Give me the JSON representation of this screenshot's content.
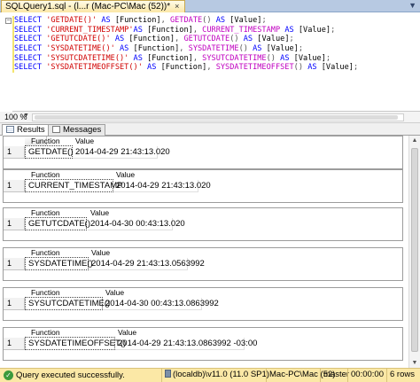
{
  "document_tab": {
    "title": "SQLQuery1.sql - (l...r (Mac-PC\\Mac (52))*",
    "close_glyph": "×"
  },
  "editor": {
    "lines": [
      [
        {
          "t": "SELECT ",
          "c": "kw"
        },
        {
          "t": "'GETDATE()'",
          "c": "str"
        },
        {
          "t": " AS ",
          "c": "kw"
        },
        {
          "t": "[Function]",
          "c": "plain"
        },
        {
          "t": ", ",
          "c": "op"
        },
        {
          "t": "GETDATE",
          "c": "fn"
        },
        {
          "t": "() ",
          "c": "op"
        },
        {
          "t": "AS ",
          "c": "kw"
        },
        {
          "t": "[Value]",
          "c": "plain"
        },
        {
          "t": ";",
          "c": "op"
        }
      ],
      [
        {
          "t": "SELECT ",
          "c": "kw"
        },
        {
          "t": "'CURRENT_TIMESTAMP'",
          "c": "str"
        },
        {
          "t": "AS ",
          "c": "kw"
        },
        {
          "t": "[Function]",
          "c": "plain"
        },
        {
          "t": ", ",
          "c": "op"
        },
        {
          "t": "CURRENT_TIMESTAMP",
          "c": "fn"
        },
        {
          "t": " AS ",
          "c": "kw"
        },
        {
          "t": "[Value]",
          "c": "plain"
        },
        {
          "t": ";",
          "c": "op"
        }
      ],
      [
        {
          "t": "SELECT ",
          "c": "kw"
        },
        {
          "t": "'GETUTCDATE()'",
          "c": "str"
        },
        {
          "t": " AS ",
          "c": "kw"
        },
        {
          "t": "[Function]",
          "c": "plain"
        },
        {
          "t": ", ",
          "c": "op"
        },
        {
          "t": "GETUTCDATE",
          "c": "fn"
        },
        {
          "t": "() ",
          "c": "op"
        },
        {
          "t": "AS ",
          "c": "kw"
        },
        {
          "t": "[Value]",
          "c": "plain"
        },
        {
          "t": ";",
          "c": "op"
        }
      ],
      [
        {
          "t": "SELECT ",
          "c": "kw"
        },
        {
          "t": "'SYSDATETIME()'",
          "c": "str"
        },
        {
          "t": " AS ",
          "c": "kw"
        },
        {
          "t": "[Function]",
          "c": "plain"
        },
        {
          "t": ", ",
          "c": "op"
        },
        {
          "t": "SYSDATETIME",
          "c": "fn"
        },
        {
          "t": "() ",
          "c": "op"
        },
        {
          "t": "AS ",
          "c": "kw"
        },
        {
          "t": "[Value]",
          "c": "plain"
        },
        {
          "t": ";",
          "c": "op"
        }
      ],
      [
        {
          "t": "SELECT ",
          "c": "kw"
        },
        {
          "t": "'SYSUTCDATETIME()'",
          "c": "str"
        },
        {
          "t": " AS ",
          "c": "kw"
        },
        {
          "t": "[Function]",
          "c": "plain"
        },
        {
          "t": ", ",
          "c": "op"
        },
        {
          "t": "SYSUTCDATETIME",
          "c": "fn"
        },
        {
          "t": "() ",
          "c": "op"
        },
        {
          "t": "AS ",
          "c": "kw"
        },
        {
          "t": "[Value]",
          "c": "plain"
        },
        {
          "t": ";",
          "c": "op"
        }
      ],
      [
        {
          "t": "SELECT ",
          "c": "kw"
        },
        {
          "t": "'SYSDATETIMEOFFSET()'",
          "c": "str"
        },
        {
          "t": " AS ",
          "c": "kw"
        },
        {
          "t": "[Function]",
          "c": "plain"
        },
        {
          "t": ", ",
          "c": "op"
        },
        {
          "t": "SYSDATETIMEOFFSET",
          "c": "fn"
        },
        {
          "t": "() ",
          "c": "op"
        },
        {
          "t": "AS ",
          "c": "kw"
        },
        {
          "t": "[Value]",
          "c": "plain"
        },
        {
          "t": ";",
          "c": "op"
        }
      ]
    ]
  },
  "zoom": {
    "level": "100 %"
  },
  "result_tabs": {
    "results": "Results",
    "messages": "Messages"
  },
  "grids": [
    {
      "col_function": "Function",
      "col_value": "Value",
      "row_num": "1",
      "function": "GETDATE()",
      "value": "2014-04-29 21:43:13.020"
    },
    {
      "col_function": "Function",
      "col_value": "Value",
      "row_num": "1",
      "function": "CURRENT_TIMESTAMP",
      "value": "2014-04-29 21:43:13.020"
    },
    {
      "col_function": "Function",
      "col_value": "Value",
      "row_num": "1",
      "function": "GETUTCDATE()",
      "value": "2014-04-30 00:43:13.020"
    },
    {
      "col_function": "Function",
      "col_value": "Value",
      "row_num": "1",
      "function": "SYSDATETIME()",
      "value": "2014-04-29 21:43:13.0563992"
    },
    {
      "col_function": "Function",
      "col_value": "Value",
      "row_num": "1",
      "function": "SYSUTCDATETIME()",
      "value": "2014-04-30 00:43:13.0863992"
    },
    {
      "col_function": "Function",
      "col_value": "Value",
      "row_num": "1",
      "function": "SYSDATETIMEOFFSET()",
      "value": "2014-04-29 21:43:13.0863992 -03:00"
    }
  ],
  "status": {
    "message": "Query executed successfully.",
    "server": "(localdb)\\v11.0 (11.0 SP1)",
    "user": "Mac-PC\\Mac (52)",
    "database": "master",
    "elapsed": "00:00:00",
    "rows": "6 rows"
  },
  "colors": {
    "keyword": "#0000ff",
    "string": "#d00000",
    "function": "#c000c0",
    "status_bar": "#fbe8a6"
  }
}
